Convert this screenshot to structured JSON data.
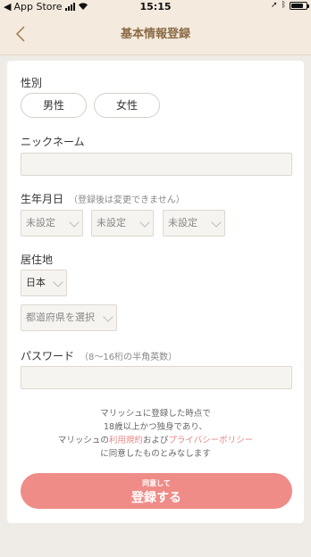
{
  "status_bar": {
    "carrier": "App Store",
    "time": "15:15",
    "battery_level": 0.8
  },
  "nav": {
    "back_icon": "chevron-left-icon",
    "title": "基本情報登録"
  },
  "form": {
    "gender": {
      "label": "性別",
      "options": [
        "男性",
        "女性"
      ]
    },
    "nickname": {
      "label": "ニックネーム",
      "value": "",
      "placeholder": ""
    },
    "birthday": {
      "label": "生年月日",
      "note": "（登録後は変更できません）",
      "year": "未設定",
      "month": "未設定",
      "day": "未設定"
    },
    "residence": {
      "label": "居住地",
      "country": "日本",
      "prefecture": "都道府県を選択"
    },
    "password": {
      "label": "パスワード",
      "note": "（8〜16桁の半角英数）",
      "value": ""
    }
  },
  "terms": {
    "line1": "マリッシュに登録した時点で",
    "line2": "18歳以上かつ独身であり、",
    "line3_prefix": "マリッシュの",
    "terms_link": "利用規約",
    "and": "および",
    "privacy_link": "プライバシーポリシー",
    "line4": "に同意したものとみなします"
  },
  "submit": {
    "small_label": "同意して",
    "label": "登録する"
  },
  "colors": {
    "accent": "#ef8c88",
    "nav_title": "#8a6a44",
    "link": "#e58989"
  }
}
